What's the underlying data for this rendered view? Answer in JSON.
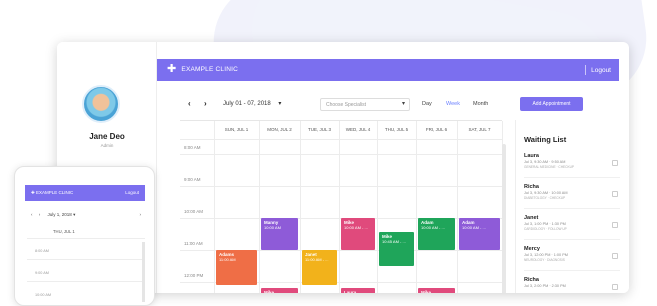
{
  "app": {
    "brand": "EXAMPLE CLINIC",
    "logout": "Logout",
    "accent": "#7b6fef"
  },
  "profile": {
    "name": "Jane Deo",
    "role": "Admin"
  },
  "toolbar": {
    "prev": "‹",
    "next": "›",
    "date_range": "July 01 - 07, 2018",
    "date_caret": "▾",
    "specialist_placeholder": "Choose Specialist",
    "views": [
      "Day",
      "Week",
      "Month"
    ],
    "active_view": "Week",
    "add_button": "Add Appointment"
  },
  "calendar": {
    "days": [
      "SUN, JUL 1",
      "MON, JUL 2",
      "TUE, JUL 3",
      "WED, JUL 4",
      "THU, JUL 5",
      "FRI, JUL 6",
      "SAT, JUL 7"
    ],
    "times": [
      "8:00 AM",
      "9:00 AM",
      "10:00 AM",
      "11:00 AM",
      "12:00 PM"
    ],
    "events": [
      {
        "name": "Manny",
        "time": "10:00 AM",
        "day": 1,
        "start": 10.0,
        "end": 11.0,
        "color": "#8e5bd8"
      },
      {
        "name": "Mike",
        "time": "10:00 AM - ...",
        "day": 3,
        "start": 10.0,
        "end": 11.0,
        "color": "#e04a7c"
      },
      {
        "name": "Mike",
        "time": "10:45 AM - ...",
        "day": 4,
        "start": 10.45,
        "end": 11.5,
        "color": "#1fa55a"
      },
      {
        "name": "Adam",
        "time": "10:00 AM - ...",
        "day": 5,
        "start": 10.0,
        "end": 11.0,
        "color": "#1fa55a"
      },
      {
        "name": "Adam",
        "time": "10:00 AM - ...",
        "day": 6,
        "start": 10.0,
        "end": 11.0,
        "color": "#8e5bd8"
      },
      {
        "name": "Adams",
        "time": "11:00 AM",
        "day": 0,
        "start": 11.0,
        "end": 12.1,
        "color": "#ef6e46"
      },
      {
        "name": "Janet",
        "time": "11:00 AM - ...",
        "day": 2,
        "start": 11.0,
        "end": 12.1,
        "color": "#f2b21b"
      },
      {
        "name": "Mike",
        "time": "",
        "day": 1,
        "start": 12.2,
        "end": 12.6,
        "color": "#e04a7c"
      },
      {
        "name": "Laura",
        "time": "",
        "day": 3,
        "start": 12.2,
        "end": 12.6,
        "color": "#e04a7c"
      },
      {
        "name": "Mike",
        "time": "",
        "day": 5,
        "start": 12.2,
        "end": 12.6,
        "color": "#e04a7c"
      }
    ]
  },
  "waiting": {
    "title": "Waiting List",
    "items": [
      {
        "name": "Laura",
        "date": "Jul 3, 9:30 AM · 9:50 AM",
        "sub": "GENERAL MEDICINE · CHECKUP"
      },
      {
        "name": "Richa",
        "date": "Jul 3, 9:30 AM · 10:00 AM",
        "sub": "DIABETOLOGY · CHECKUP"
      },
      {
        "name": "Janet",
        "date": "Jul 3, 1:00 PM · 1:30 PM",
        "sub": "CARDIOLOGY · FOLLOW UP"
      },
      {
        "name": "Mercy",
        "date": "Jul 3, 12:00 PM · 1:00 PM",
        "sub": "NEUROLOGY · DIAGNOSIS"
      },
      {
        "name": "Richa",
        "date": "Jul 3, 2:00 PM · 2:30 PM",
        "sub": ""
      }
    ]
  },
  "phone": {
    "brand": "EXAMPLE CLINIC",
    "logout": "Logout",
    "date_range": "July 1, 2018",
    "date_caret": "▾",
    "prev": "‹",
    "next": "›",
    "day_label": "THU, JUL 1",
    "times": [
      "8:00 AM",
      "9:00 AM",
      "10:00 AM"
    ]
  }
}
